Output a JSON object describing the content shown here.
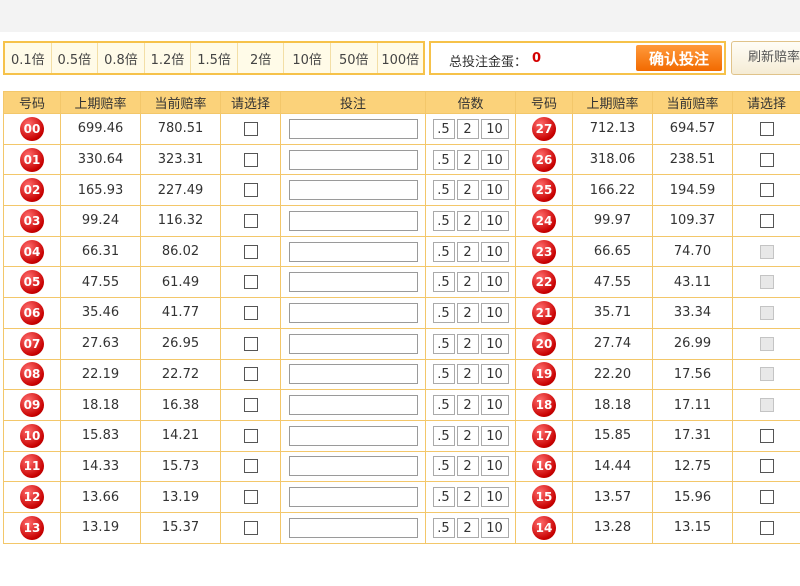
{
  "multipliers": [
    "0.1倍",
    "0.5倍",
    "0.8倍",
    "1.2倍",
    "1.5倍",
    "2倍",
    "10倍",
    "50倍",
    "100倍"
  ],
  "total": {
    "label": "总投注金蛋：",
    "value": "0"
  },
  "confirm_label": "确认投注",
  "refresh_label": "刷新赔率",
  "headers": {
    "left": [
      "号码",
      "上期赔率",
      "当前赔率",
      "请选择",
      "投注",
      "倍数"
    ],
    "right": [
      "号码",
      "上期赔率",
      "当前赔率",
      "请选择"
    ]
  },
  "quick_mult": [
    ".5",
    "2",
    "10"
  ],
  "rows": [
    {
      "left": {
        "num": "00",
        "prev": "699.46",
        "curr": "780.51"
      },
      "right": {
        "num": "27",
        "prev": "712.13",
        "curr": "694.57",
        "enabled": true
      }
    },
    {
      "left": {
        "num": "01",
        "prev": "330.64",
        "curr": "323.31"
      },
      "right": {
        "num": "26",
        "prev": "318.06",
        "curr": "238.51",
        "enabled": true
      }
    },
    {
      "left": {
        "num": "02",
        "prev": "165.93",
        "curr": "227.49"
      },
      "right": {
        "num": "25",
        "prev": "166.22",
        "curr": "194.59",
        "enabled": true
      }
    },
    {
      "left": {
        "num": "03",
        "prev": "99.24",
        "curr": "116.32"
      },
      "right": {
        "num": "24",
        "prev": "99.97",
        "curr": "109.37",
        "enabled": true
      }
    },
    {
      "left": {
        "num": "04",
        "prev": "66.31",
        "curr": "86.02"
      },
      "right": {
        "num": "23",
        "prev": "66.65",
        "curr": "74.70",
        "enabled": false
      }
    },
    {
      "left": {
        "num": "05",
        "prev": "47.55",
        "curr": "61.49"
      },
      "right": {
        "num": "22",
        "prev": "47.55",
        "curr": "43.11",
        "enabled": false
      }
    },
    {
      "left": {
        "num": "06",
        "prev": "35.46",
        "curr": "41.77"
      },
      "right": {
        "num": "21",
        "prev": "35.71",
        "curr": "33.34",
        "enabled": false
      }
    },
    {
      "left": {
        "num": "07",
        "prev": "27.63",
        "curr": "26.95"
      },
      "right": {
        "num": "20",
        "prev": "27.74",
        "curr": "26.99",
        "enabled": false
      }
    },
    {
      "left": {
        "num": "08",
        "prev": "22.19",
        "curr": "22.72"
      },
      "right": {
        "num": "19",
        "prev": "22.20",
        "curr": "17.56",
        "enabled": false
      }
    },
    {
      "left": {
        "num": "09",
        "prev": "18.18",
        "curr": "16.38"
      },
      "right": {
        "num": "18",
        "prev": "18.18",
        "curr": "17.11",
        "enabled": false
      }
    },
    {
      "left": {
        "num": "10",
        "prev": "15.83",
        "curr": "14.21"
      },
      "right": {
        "num": "17",
        "prev": "15.85",
        "curr": "17.31",
        "enabled": true
      }
    },
    {
      "left": {
        "num": "11",
        "prev": "14.33",
        "curr": "15.73"
      },
      "right": {
        "num": "16",
        "prev": "14.44",
        "curr": "12.75",
        "enabled": true
      }
    },
    {
      "left": {
        "num": "12",
        "prev": "13.66",
        "curr": "13.19"
      },
      "right": {
        "num": "15",
        "prev": "13.57",
        "curr": "15.96",
        "enabled": true
      }
    },
    {
      "left": {
        "num": "13",
        "prev": "13.19",
        "curr": "15.37"
      },
      "right": {
        "num": "14",
        "prev": "13.28",
        "curr": "13.15",
        "enabled": true
      }
    }
  ]
}
